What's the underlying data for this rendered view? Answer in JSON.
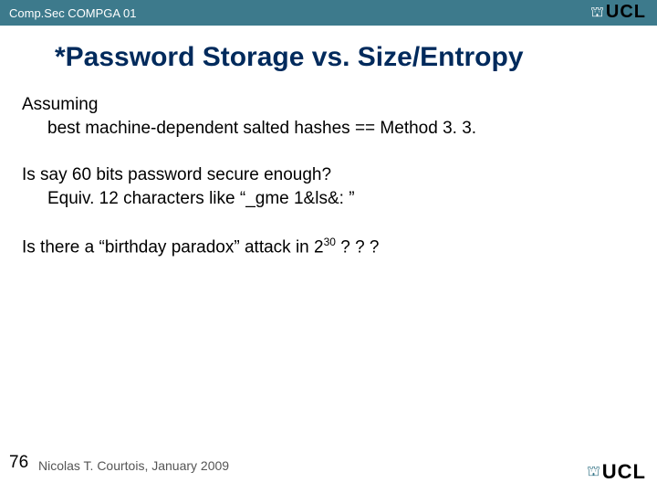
{
  "header": {
    "course": "Comp.Sec COMPGA 01",
    "logo_text": "UCL"
  },
  "title": "*Password Storage vs. Size/Entropy",
  "body": {
    "p1_l1": "Assuming",
    "p1_l2": "best machine-dependent salted hashes == Method 3. 3.",
    "p2_l1": "Is say 60 bits password secure enough?",
    "p2_l2_a": "Equiv. 12 characters like ",
    "p2_l2_q1": "“",
    "p2_l2_b": "_gme 1&ls&: ",
    "p2_l2_q2": "”",
    "p3_a": "Is there a ",
    "p3_q1": "“",
    "p3_b": "birthday paradox",
    "p3_q2": "”",
    "p3_c": " attack in 2",
    "p3_sup": "30",
    "p3_d": " ? ? ?"
  },
  "footer": {
    "slide_number": "76",
    "author": "Nicolas T. Courtois, January 2009",
    "logo_text": "UCL"
  }
}
